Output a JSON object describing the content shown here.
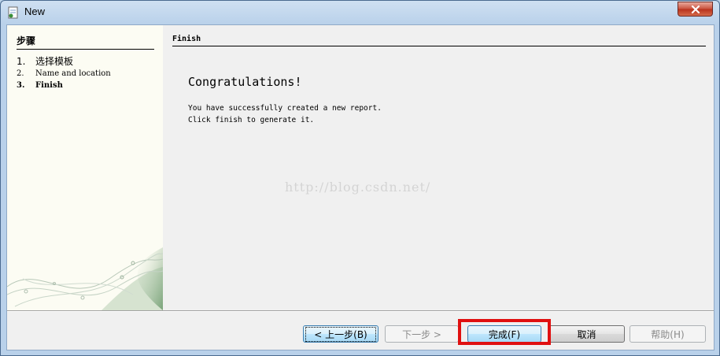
{
  "window": {
    "title": "New"
  },
  "steps": {
    "header": "步骤",
    "items": [
      {
        "num": "1.",
        "label": "选择模板"
      },
      {
        "num": "2.",
        "label": "Name and location"
      },
      {
        "num": "3.",
        "label": "Finish"
      }
    ],
    "current_index": 2
  },
  "content": {
    "header": "Finish",
    "title": "Congratulations!",
    "line1": "You have successfully created a new report.",
    "line2": "Click finish to generate it.",
    "watermark": "http://blog.csdn.net/"
  },
  "buttons": {
    "back": "< 上一步(B)",
    "next": "下一步 >",
    "finish": "完成(F)",
    "cancel": "取消",
    "help": "帮助(H)"
  },
  "icons": {
    "app": "new-report-app-icon",
    "close": "close-icon"
  },
  "colors": {
    "highlight": "#e01010",
    "steps_bg": "#fcfcf3",
    "content_bg": "#f0f0f0"
  }
}
